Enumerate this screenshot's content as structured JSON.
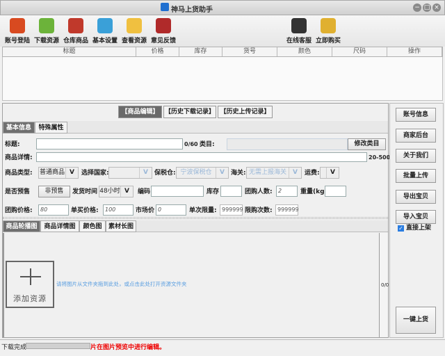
{
  "window": {
    "title": "神马上货助手",
    "min": "−",
    "max": "□",
    "close": "×"
  },
  "toolbar": {
    "items": [
      {
        "label": "账号登陆",
        "color": "#d84a20"
      },
      {
        "label": "下载资源",
        "color": "#6cb33a"
      },
      {
        "label": "仓库商品",
        "color": "#c0392b"
      },
      {
        "label": "基本设置",
        "color": "#3aa0d8"
      },
      {
        "label": "查看资源",
        "color": "#f0c040"
      },
      {
        "label": "意见反馈",
        "color": "#b02a2a"
      }
    ],
    "right": [
      {
        "label": "在线客服",
        "color": "#333"
      },
      {
        "label": "立即购买",
        "color": "#e0b030"
      }
    ]
  },
  "table": {
    "columns": [
      "标题",
      "价格",
      "库存",
      "货号",
      "颜色",
      "尺码",
      "操作"
    ]
  },
  "tabs": [
    "【商品编辑】",
    "【历史下载记录】",
    "【历史上传记录】"
  ],
  "subtabs": [
    "基本信息",
    "特殊属性"
  ],
  "form": {
    "title_label": "标题:",
    "title_count": "0/60",
    "category_label": "类目:",
    "edit_category": "修改类目",
    "detail_label": "商品详情:",
    "detail_range": "20-500",
    "type_label": "商品类型:",
    "type_value": "普通商品",
    "country_label": "选择国家:",
    "country_value": "",
    "bonded_label": "保税仓:",
    "bonded_value": "宁波保税仓",
    "customs_label": "海关:",
    "customs_value": "无需上报海关",
    "shipping_label": "运费:",
    "shipping_value": "",
    "presale_label": "是否预售",
    "presale_value": "非预售",
    "ship_time_label": "发货时间",
    "ship_time_value": "48小时",
    "code_label": "编码",
    "stock_label": "库存",
    "group_people_label": "团购人数:",
    "group_people_value": "2",
    "weight_label": "重量(kg)",
    "group_price_label": "团购价格:",
    "group_price_value": "80",
    "single_price_label": "单买价格:",
    "single_price_value": "100",
    "market_price_label": "市场价",
    "market_price_value": "0",
    "limit_label": "单次限量:",
    "limit_value": "999999",
    "limit_times_label": "限购次数:",
    "limit_times_value": "999999",
    "dropdown": "V"
  },
  "image_tabs": [
    "商品轮播图",
    "商品详情图",
    "颜色图",
    "素材长图"
  ],
  "images": {
    "add_label": "添加资源",
    "hint": "请将图片从文件夹拖到此处，或点击此处打开资源文件夹",
    "count": "0/0"
  },
  "side": {
    "buttons": [
      "账号信息",
      "商家后台",
      "关于我们",
      "批量上传",
      "导出宝贝",
      "导入宝贝"
    ],
    "direct_label": "直接上架",
    "direct_checked": true,
    "one_click": "一键上货"
  },
  "status": {
    "text": "下载完成",
    "message": "片在图片预览中进行编辑。"
  }
}
